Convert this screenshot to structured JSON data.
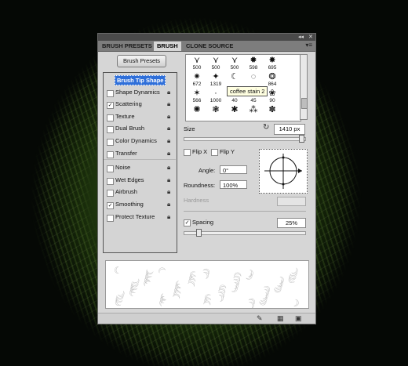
{
  "panel": {
    "title_controls": [
      "◂◂",
      "✕"
    ],
    "tabs": [
      {
        "label": "BRUSH PRESETS",
        "active": false
      },
      {
        "label": "BRUSH",
        "active": true
      },
      {
        "label": "CLONE SOURCE",
        "active": false
      }
    ],
    "tab_menu_icon": "panel-menu-icon",
    "presets_button": "Brush Presets"
  },
  "settings_list": [
    {
      "label": "Brush Tip Shape",
      "checkbox": false,
      "selected": true,
      "lock": false
    },
    {
      "label": "Shape Dynamics",
      "checkbox": true,
      "checked": false,
      "lock": true
    },
    {
      "label": "Scattering",
      "checkbox": true,
      "checked": true,
      "lock": true
    },
    {
      "label": "Texture",
      "checkbox": true,
      "checked": false,
      "lock": true
    },
    {
      "label": "Dual Brush",
      "checkbox": true,
      "checked": false,
      "lock": true
    },
    {
      "label": "Color Dynamics",
      "checkbox": true,
      "checked": false,
      "lock": true
    },
    {
      "label": "Transfer",
      "checkbox": true,
      "checked": false,
      "lock": true
    },
    {
      "label": "Noise",
      "checkbox": true,
      "checked": false,
      "lock": true
    },
    {
      "label": "Wet Edges",
      "checkbox": true,
      "checked": false,
      "lock": true
    },
    {
      "label": "Airbrush",
      "checkbox": true,
      "checked": false,
      "lock": true
    },
    {
      "label": "Smoothing",
      "checkbox": true,
      "checked": true,
      "lock": true
    },
    {
      "label": "Protect Texture",
      "checkbox": true,
      "checked": false,
      "lock": true
    }
  ],
  "brush_grid": [
    {
      "glyph": "⋎",
      "size": "500"
    },
    {
      "glyph": "⋎",
      "size": "500"
    },
    {
      "glyph": "⋎",
      "size": "500"
    },
    {
      "glyph": "✹",
      "size": "598"
    },
    {
      "glyph": "✸",
      "size": "695"
    },
    {
      "glyph": "",
      "size": ""
    },
    {
      "glyph": "✷",
      "size": "672"
    },
    {
      "glyph": "✦",
      "size": "1319"
    },
    {
      "glyph": "☾",
      "size": ""
    },
    {
      "glyph": "◌",
      "size": ""
    },
    {
      "glyph": "❂",
      "size": "864"
    },
    {
      "glyph": "",
      "size": ""
    },
    {
      "glyph": "✶",
      "size": "566"
    },
    {
      "glyph": "·",
      "size": "1000"
    },
    {
      "glyph": "⁘",
      "size": "40"
    },
    {
      "glyph": "✲",
      "size": "45"
    },
    {
      "glyph": "❀",
      "size": "90"
    },
    {
      "glyph": "",
      "size": ""
    },
    {
      "glyph": "✺",
      "size": ""
    },
    {
      "glyph": "❃",
      "size": ""
    },
    {
      "glyph": "✱",
      "size": ""
    },
    {
      "glyph": "⁂",
      "size": ""
    },
    {
      "glyph": "✽",
      "size": ""
    },
    {
      "glyph": "",
      "size": ""
    }
  ],
  "tooltip": "coffee stain 2",
  "tip": {
    "size_label": "Size",
    "size_value": "1410 px",
    "size_slider_fraction": 0.97,
    "flip_x": "Flip X",
    "flip_y": "Flip Y",
    "angle_label": "Angle:",
    "angle_value": "0°",
    "roundness_label": "Roundness:",
    "roundness_value": "100%",
    "hardness_label": "Hardness",
    "spacing_label": "Spacing",
    "spacing_checked": true,
    "spacing_value": "25%",
    "spacing_slider_fraction": 0.12
  },
  "bottom_icons": [
    "toggle-brush-preview-icon",
    "grid-icon",
    "new-preset-icon"
  ]
}
